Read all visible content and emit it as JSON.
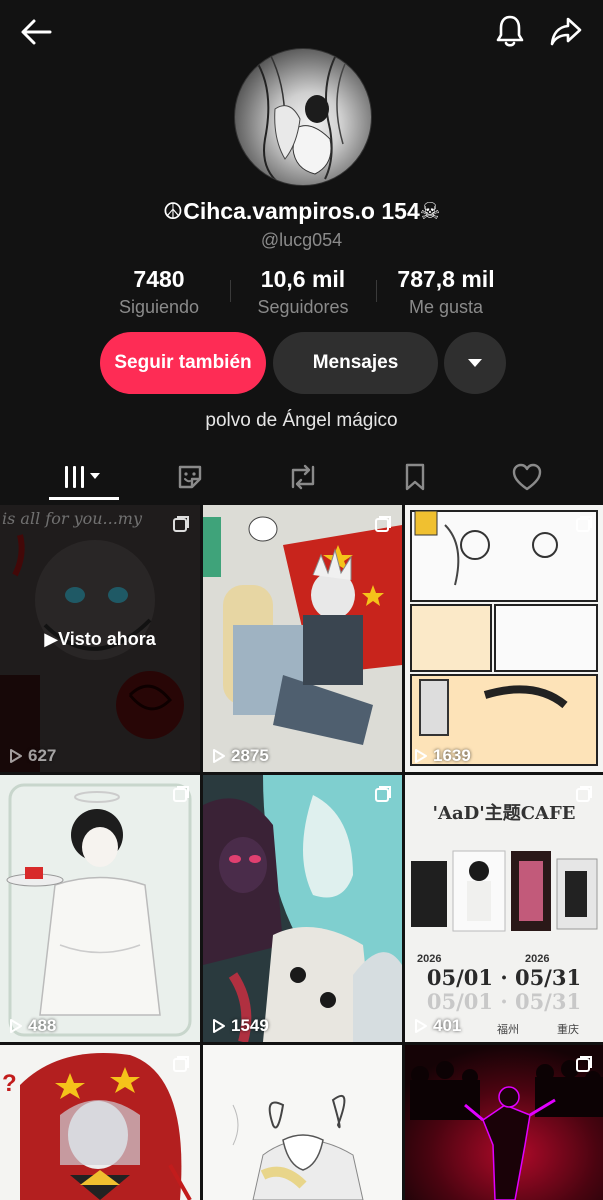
{
  "profile": {
    "display_name": "☮Cihca.vampiros.o 154☠",
    "username": "@lucg054",
    "bio": "polvo de Ángel mágico"
  },
  "stats": [
    {
      "value": "7480",
      "label": "Siguiendo"
    },
    {
      "value": "10,6 mil",
      "label": "Seguidores"
    },
    {
      "value": "787,8 mil",
      "label": "Me gusta"
    }
  ],
  "actions": {
    "follow_label": "Seguir también",
    "message_label": "Mensajes",
    "more_icon": "caret-down-icon"
  },
  "icons": {
    "back": "arrow-left-icon",
    "notifications": "bell-icon",
    "share": "share-arrow-icon"
  },
  "tabs": [
    {
      "name": "videos",
      "icon": "grid-bars-icon",
      "active": true
    },
    {
      "name": "stickers",
      "icon": "sticker-icon",
      "active": false
    },
    {
      "name": "reposts",
      "icon": "repost-icon",
      "active": false
    },
    {
      "name": "favorites",
      "icon": "bookmark-icon",
      "active": false
    },
    {
      "name": "liked",
      "icon": "heart-icon",
      "active": false
    }
  ],
  "videos": [
    {
      "views": "627",
      "watched_label": "Visto ahora",
      "multi": true
    },
    {
      "views": "2875",
      "multi": true
    },
    {
      "views": "1639",
      "multi": true
    },
    {
      "views": "488",
      "multi": true
    },
    {
      "views": "1549",
      "multi": true
    },
    {
      "views": "401",
      "multi": true
    },
    {
      "views": "",
      "multi": true
    },
    {
      "views": "",
      "multi": false
    },
    {
      "views": "",
      "multi": true
    }
  ],
  "tile_texts": {
    "tile1_caption": "is all for you...my",
    "tile6_title": "'AaD'主题CAFE",
    "tile6_dates": "05/01 · 05/31",
    "tile6_year": "2026",
    "tile6_city1": "福州",
    "tile6_city2": "重庆"
  },
  "colors": {
    "background": "#121212",
    "accent_follow": "#fe2c55",
    "secondary_button": "#2f2f2f",
    "muted_text": "#8a8a8a"
  }
}
